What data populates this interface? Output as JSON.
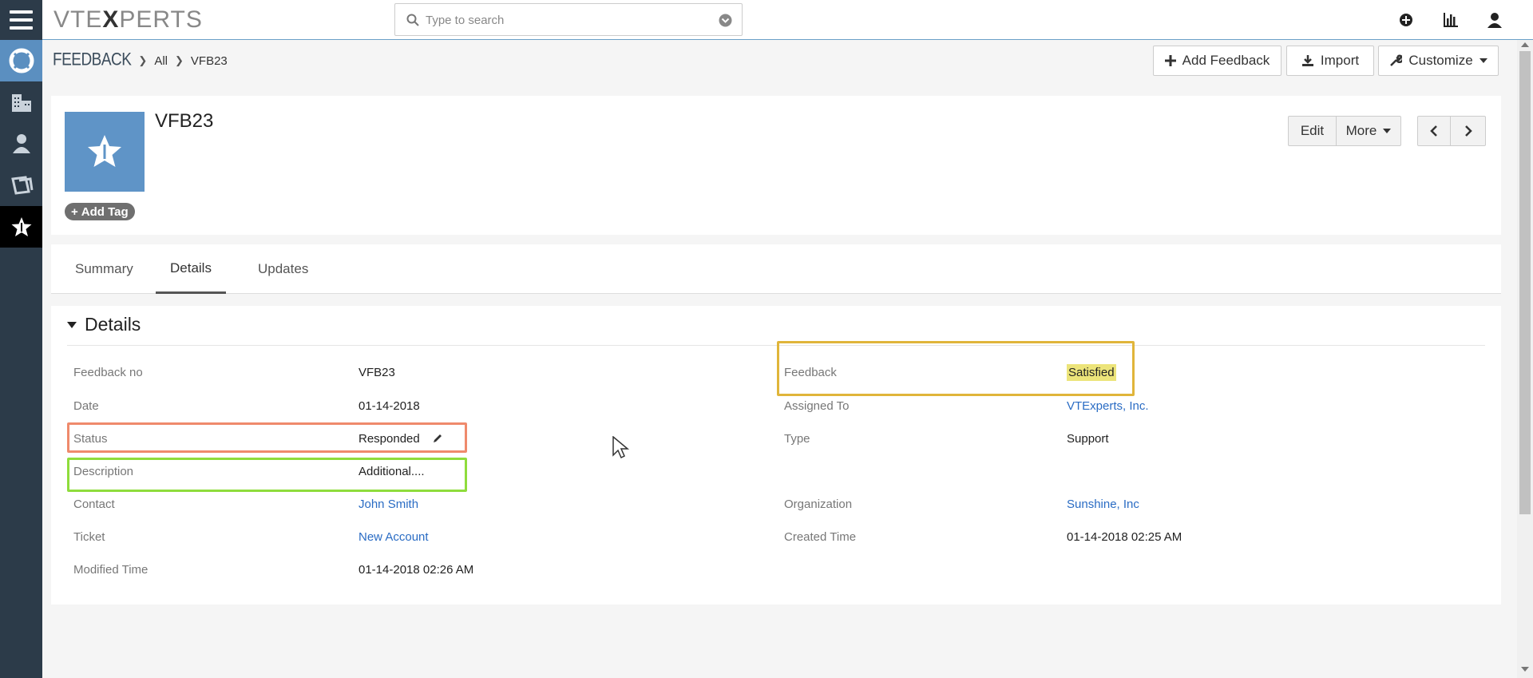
{
  "header": {
    "logo_pre": "VTE",
    "logo_x": "X",
    "logo_post": "PERTS",
    "search_placeholder": "Type to search"
  },
  "breadcrumb": {
    "module": "FEEDBACK",
    "filter": "All",
    "record": "VFB23"
  },
  "actions": {
    "add_feedback": "Add Feedback",
    "import": "Import",
    "customize": "Customize"
  },
  "record": {
    "title": "VFB23",
    "add_tag": "Add Tag",
    "edit": "Edit",
    "more": "More"
  },
  "tabs": [
    "Summary",
    "Details",
    "Updates"
  ],
  "details": {
    "section_title": "Details",
    "left": [
      {
        "label": "Feedback no",
        "value": "VFB23"
      },
      {
        "label": "Date",
        "value": "01-14-2018"
      },
      {
        "label": "Status",
        "value": "Responded"
      },
      {
        "label": "Description",
        "value": "Additional...."
      },
      {
        "label": "Contact",
        "value": "John Smith"
      },
      {
        "label": "Ticket",
        "value": "New Account"
      },
      {
        "label": "Modified Time",
        "value": "01-14-2018 02:26 AM"
      }
    ],
    "right": [
      {
        "label": "Feedback",
        "value": "Satisfied"
      },
      {
        "label": "Assigned To",
        "value": "VTExperts, Inc."
      },
      {
        "label": "Type",
        "value": "Support"
      },
      {
        "label": "Organization",
        "value": "Sunshine, Inc"
      },
      {
        "label": "Created Time",
        "value": "01-14-2018 02:25 AM"
      }
    ]
  },
  "colors": {
    "sidebar": "#2c3b49",
    "highlight_feedback": "#e0b53a",
    "highlight_status": "#ef8a6c",
    "highlight_description": "#8fdc3c",
    "link": "#2a6cc4"
  }
}
